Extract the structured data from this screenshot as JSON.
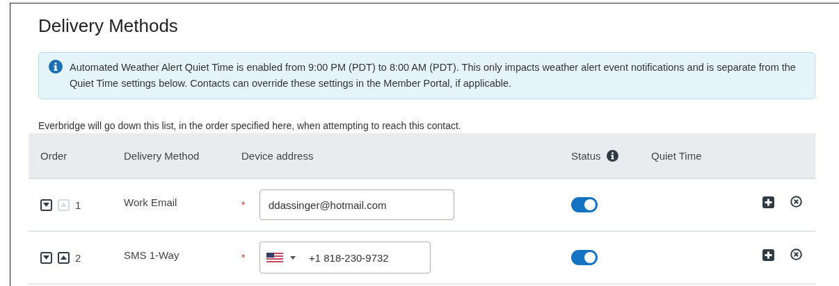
{
  "title": "Delivery Methods",
  "info": "Automated Weather Alert Quiet Time is enabled from 9:00 PM (PDT) to 8:00 AM (PDT). This only impacts weather alert event notifications and is separate from the Quiet Time settings below. Contacts can override these settings in the Member Portal, if applicable.",
  "helper": "Everbridge will go down this list, in the order specified here, when attempting to reach this contact.",
  "table": {
    "columns": [
      "Order",
      "Delivery Method",
      "Device address",
      "Status",
      "Quiet Time"
    ],
    "rows": [
      {
        "order": "1",
        "method": "Work Email",
        "kind": "email",
        "required": "*",
        "address": "ddassinger@hotmail.com",
        "down_disabled": false,
        "up_disabled": true,
        "on": true
      },
      {
        "order": "2",
        "method": "SMS 1-Way",
        "kind": "phone",
        "required": "*",
        "address": "+1 818-230-9732",
        "down_disabled": false,
        "up_disabled": false,
        "on": true
      }
    ]
  }
}
